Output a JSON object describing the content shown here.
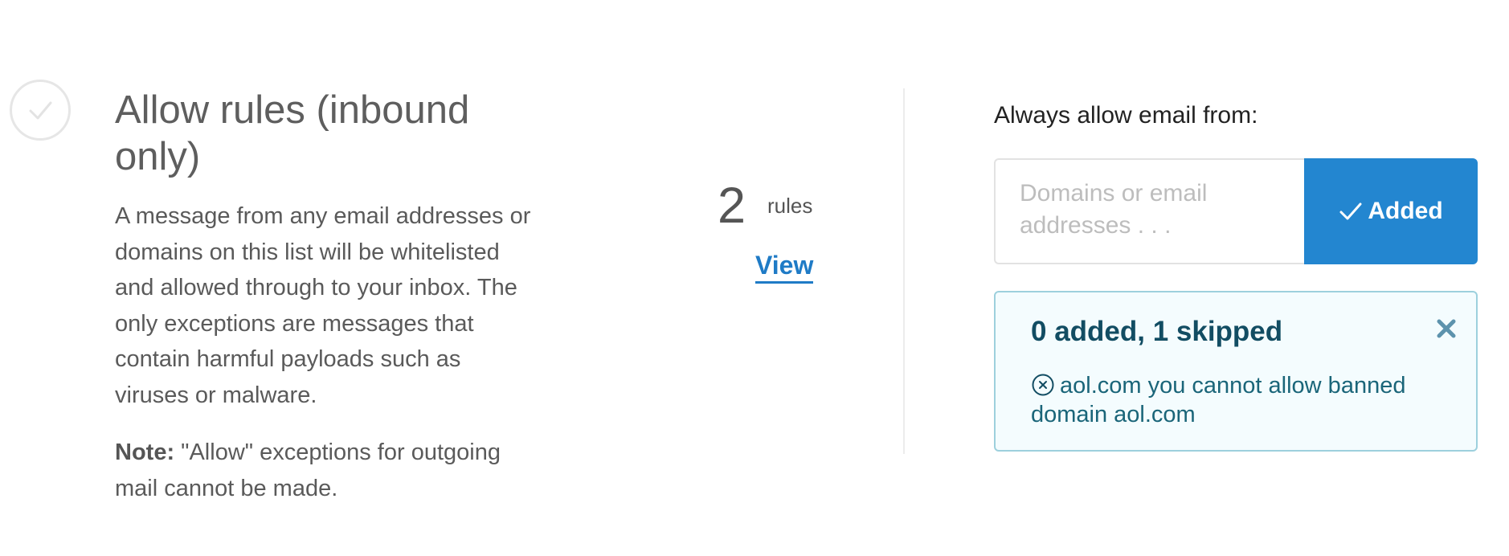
{
  "rule": {
    "title": "Allow rules (inbound only)",
    "description": "A message from any email addresses or domains on this list will be whitelisted and allowed through to your inbox. The only exceptions are messages that contain harmful payloads such as viruses or malware.",
    "note_label": "Note:",
    "note_text": " \"Allow\" exceptions for outgoing mail cannot be made.",
    "status_icon": "check-circle-icon"
  },
  "rules_summary": {
    "count": "2",
    "unit": "rules",
    "view_label": "View"
  },
  "allow_form": {
    "label": "Always allow email from:",
    "input_value": "",
    "input_placeholder": "Domains or email addresses . . .",
    "button_label": "Added",
    "button_icon": "checkmark-icon"
  },
  "result": {
    "title": "0 added, 1 skipped",
    "close_icon": "close-icon",
    "skipped_icon": "x-circle-icon",
    "skipped_message": "aol.com you cannot allow banned domain aol.com"
  },
  "colors": {
    "accent": "#2386d0",
    "link": "#1f7bc6",
    "result_border": "#9dd0dd",
    "result_bg": "#f4fcfe",
    "result_title": "#124d63",
    "result_text": "#1a6579"
  }
}
